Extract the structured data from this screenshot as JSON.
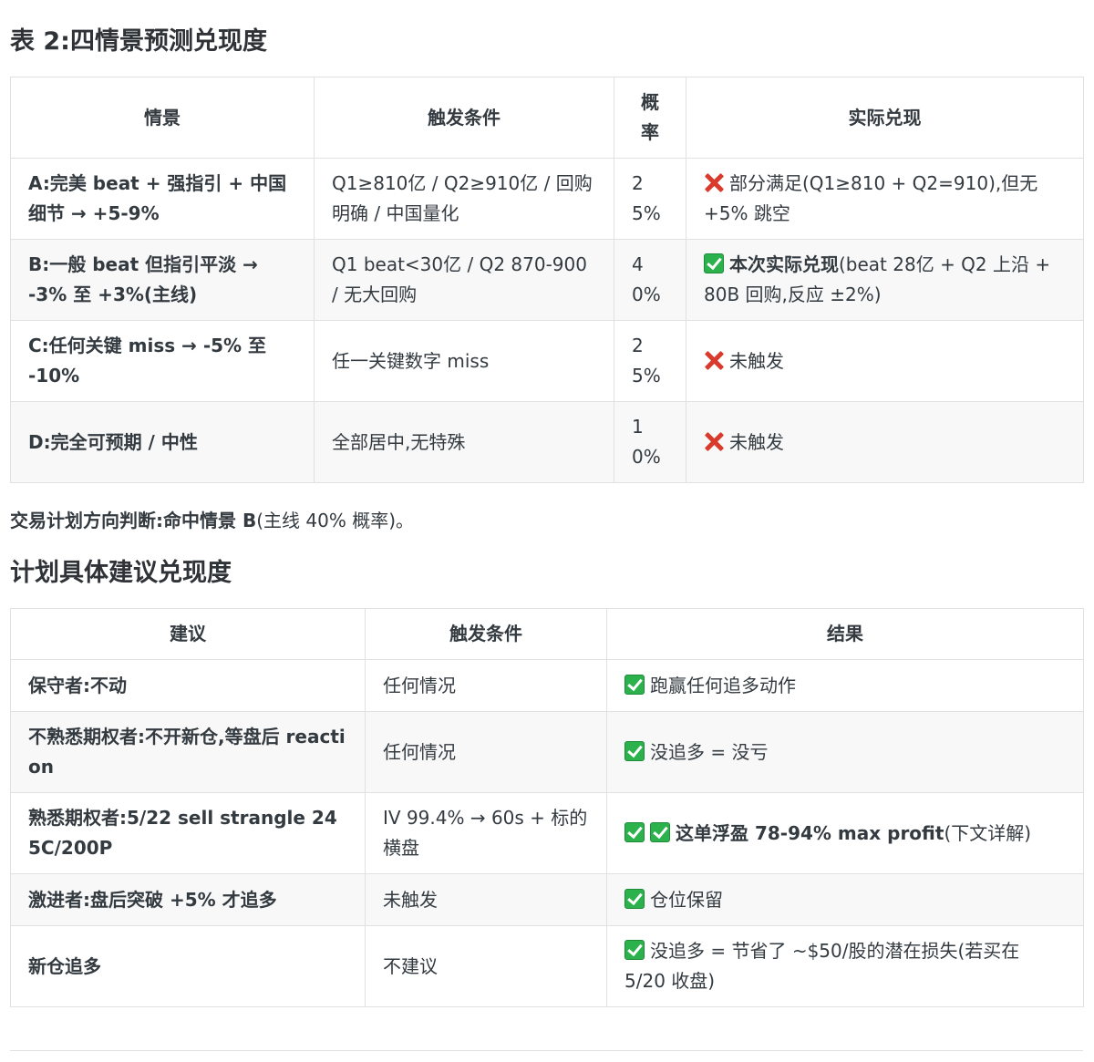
{
  "table1": {
    "heading": "表 2:四情景预测兑现度",
    "headers": {
      "scenario": "情景",
      "trigger": "触发条件",
      "prob": "概率",
      "actual": "实际兑现"
    },
    "rows": [
      {
        "scenario": "A:完美 beat + 强指引 + 中国细节 → +5-9%",
        "trigger": "Q1≥810亿 / Q2≥910亿 / 回购明确 / 中国量化",
        "prob": "25%",
        "mark": "cross",
        "actual_bold": "",
        "actual": "部分满足(Q1≥810 + Q2=910),但无 +5% 跳空"
      },
      {
        "scenario": "B:一般 beat 但指引平淡 → -3% 至 +3%(主线)",
        "trigger": "Q1 beat<30亿 / Q2 870-900 / 无大回购",
        "prob": "40%",
        "mark": "check",
        "actual_bold": "本次实际兑现",
        "actual": "(beat 28亿 + Q2 上沿 + 80B 回购,反应 ±2%)"
      },
      {
        "scenario": "C:任何关键 miss → -5% 至 -10%",
        "trigger": "任一关键数字 miss",
        "prob": "25%",
        "mark": "cross",
        "actual_bold": "",
        "actual": "未触发"
      },
      {
        "scenario": "D:完全可预期 / 中性",
        "trigger": "全部居中,无特殊",
        "prob": "10%",
        "mark": "cross",
        "actual_bold": "",
        "actual": "未触发"
      }
    ]
  },
  "conclusion": {
    "bold": "交易计划方向判断:命中情景 B",
    "rest": "(主线 40% 概率)。"
  },
  "table2": {
    "heading": "计划具体建议兑现度",
    "headers": {
      "advice": "建议",
      "trigger": "触发条件",
      "result": "结果"
    },
    "rows": [
      {
        "advice": "保守者:不动",
        "trigger": "任何情况",
        "marks": 1,
        "result_bold": "",
        "result": "跑赢任何追多动作"
      },
      {
        "advice": "不熟悉期权者:不开新仓,等盘后 reaction",
        "trigger": "任何情况",
        "marks": 1,
        "result_bold": "",
        "result": "没追多 = 没亏"
      },
      {
        "advice": "熟悉期权者:5/22 sell strangle 245C/200P",
        "trigger": "IV 99.4% → 60s + 标的横盘",
        "marks": 2,
        "result_bold": "这单浮盈 78-94% max profit",
        "result": "(下文详解)"
      },
      {
        "advice": "激进者:盘后突破 +5% 才追多",
        "trigger": "未触发",
        "marks": 1,
        "result_bold": "",
        "result": "仓位保留"
      },
      {
        "advice": "新仓追多",
        "trigger": "不建议",
        "marks": 1,
        "result_bold": "",
        "result": "没追多 = 节省了 ~$50/股的潜在损失(若买在 5/20 收盘)"
      }
    ]
  }
}
